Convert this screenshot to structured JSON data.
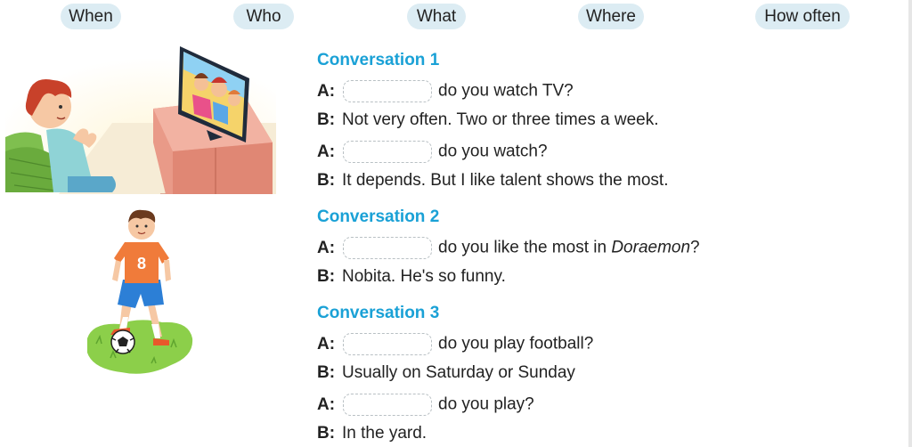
{
  "word_bank": [
    "When",
    "Who",
    "What",
    "Where",
    "How often"
  ],
  "conversations": [
    {
      "title": "Conversation 1",
      "lines": [
        {
          "speaker": "A:",
          "text": "do you watch TV?"
        },
        {
          "speaker": "B:",
          "text": "Not very often. Two or three times a week."
        },
        {
          "speaker": "A:",
          "text": "do you watch?"
        },
        {
          "speaker": "B:",
          "text": "It depends. But I like talent shows the most."
        }
      ]
    },
    {
      "title": "Conversation 2",
      "lines": [
        {
          "speaker": "A:",
          "text_before": "do you like the most in ",
          "text_italic": "Doraemon",
          "text_after": "?"
        },
        {
          "speaker": "B:",
          "text": "Nobita. He's so funny."
        }
      ]
    },
    {
      "title": "Conversation 3",
      "lines": [
        {
          "speaker": "A:",
          "text": "do you play football?"
        },
        {
          "speaker": "B:",
          "text": "Usually on Saturday or Sunday"
        },
        {
          "speaker": "A:",
          "text": "do you play?"
        },
        {
          "speaker": "B:",
          "text": "In the yard."
        }
      ]
    }
  ],
  "illustrations": {
    "top": "boy-watching-tv-illustration",
    "bottom": "boy-with-football-illustration",
    "shirt_number": "8"
  },
  "colors": {
    "chip_bg": "#dcecf3",
    "title": "#1aa1d6",
    "blank_border": "#b9c0c4"
  }
}
